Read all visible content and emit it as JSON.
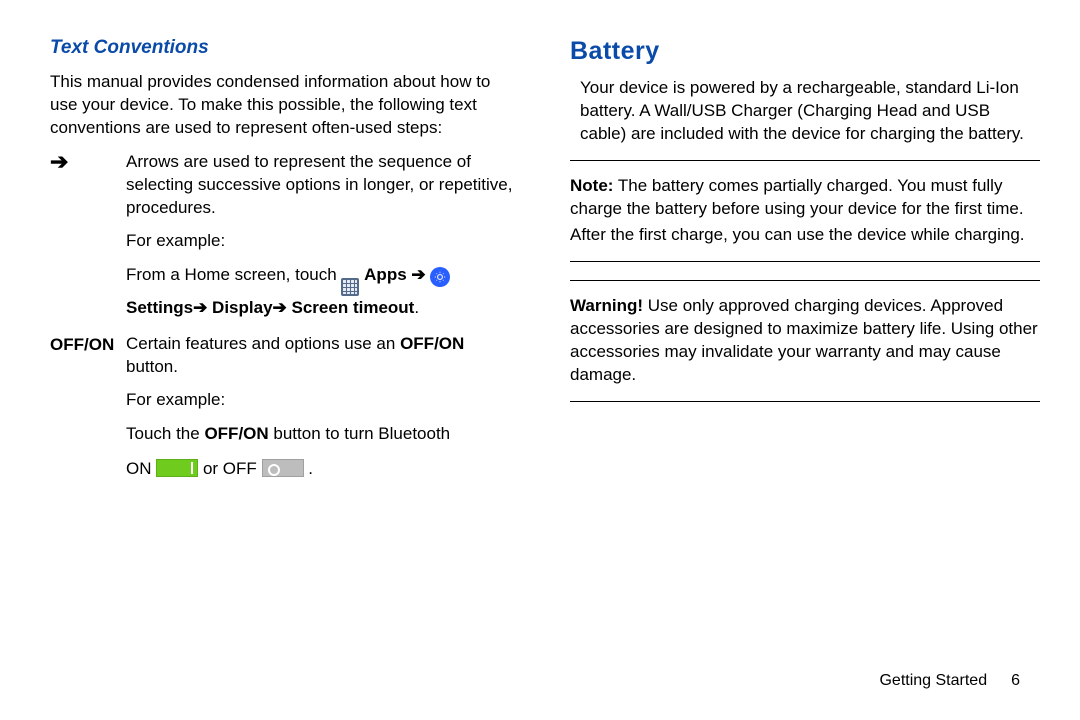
{
  "left": {
    "heading": "Text Conventions",
    "intro": "This manual provides condensed information about how to use your device. To make this possible, the following text conventions are used to represent often-used steps:",
    "arrow": {
      "symbol": "➔",
      "desc": "Arrows are used to represent the sequence of selecting successive options in longer, or repetitive, procedures.",
      "for_example": "For example:",
      "line1_a": "From a Home screen, touch ",
      "line1_apps": " Apps ",
      "line2_settings": "Settings",
      "line2_display": " Display",
      "line2_timeout": " Screen timeout",
      "period": "."
    },
    "offon": {
      "term": "OFF/ON",
      "desc_a": "Certain features and options use an ",
      "desc_b": "OFF/ON",
      "desc_c": " button.",
      "for_example": "For example:",
      "touch_a": "Touch the ",
      "touch_b": "OFF/ON",
      "touch_c": " button to turn Bluetooth",
      "on_label": "ON ",
      "or_label": " or OFF ",
      "end": " ."
    }
  },
  "right": {
    "heading": "Battery",
    "intro": "Your device is powered by a rechargeable, standard Li-Ion battery. A Wall/USB Charger (Charging Head and USB cable) are included with the device for charging the battery.",
    "note_label": "Note:",
    "note_body": " The battery comes partially charged. You must fully charge the battery before using your device for the first time.",
    "note_body2": "After the first charge, you can use the device while charging.",
    "warn_label": "Warning!",
    "warn_body": " Use only approved charging devices. Approved accessories are designed to maximize battery life. Using other accessories may invalidate your warranty and may cause damage."
  },
  "footer": {
    "section": "Getting Started",
    "page": "6"
  }
}
